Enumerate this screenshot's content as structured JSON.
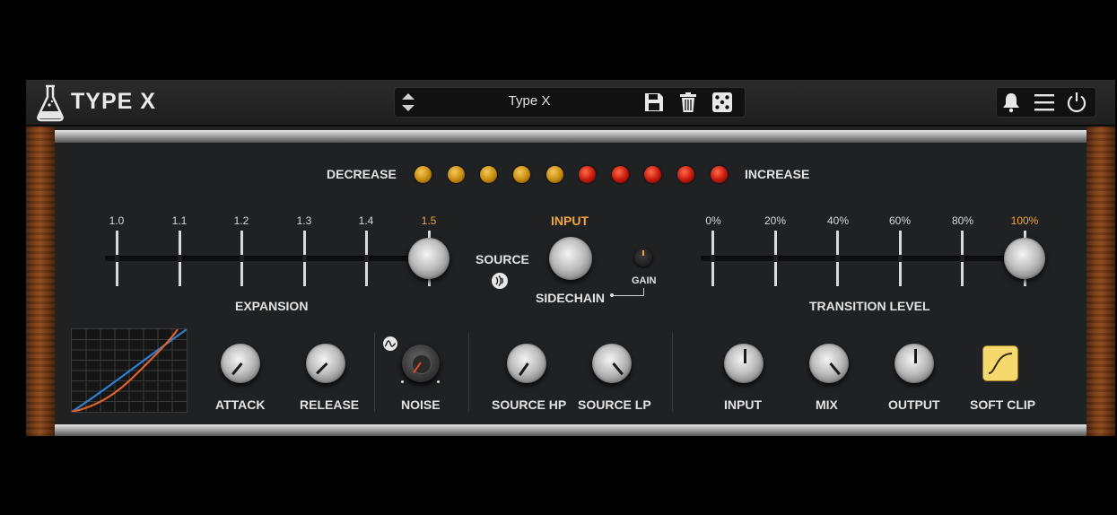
{
  "header": {
    "title": "TYPE X",
    "preset_name": "Type X",
    "icons": [
      "flask-icon",
      "preset-arrows-icon",
      "save-icon",
      "trash-icon",
      "dice-icon",
      "bell-icon",
      "menu-icon",
      "power-icon"
    ]
  },
  "meter": {
    "decrease_label": "DECREASE",
    "increase_label": "INCREASE",
    "leds": [
      "amber",
      "amber",
      "amber",
      "amber",
      "amber",
      "red",
      "red",
      "red",
      "red",
      "red"
    ]
  },
  "expansion": {
    "label": "EXPANSION",
    "ticks": [
      "1.0",
      "1.1",
      "1.2",
      "1.3",
      "1.4",
      "1.5"
    ],
    "selected_index": 5
  },
  "center": {
    "input_label": "INPUT",
    "source_label": "SOURCE",
    "sidechain_label": "SIDECHAIN",
    "gain_label": "GAIN"
  },
  "transition": {
    "label": "TRANSITION LEVEL",
    "ticks": [
      "0%",
      "20%",
      "40%",
      "60%",
      "80%",
      "100%"
    ],
    "selected_index": 5
  },
  "knobs": {
    "attack": "ATTACK",
    "release": "RELEASE",
    "noise": "NOISE",
    "source_hp": "SOURCE HP",
    "source_lp": "SOURCE LP",
    "input": "INPUT",
    "mix": "MIX",
    "output": "OUTPUT",
    "soft_clip": "SOFT CLIP"
  },
  "colors": {
    "accent_orange": "#f1a43c",
    "led_amber": "#d49a15",
    "led_red": "#c4170c",
    "soft_clip_on": "#f5d96e",
    "curve_blue": "#2f7fd0",
    "curve_orange": "#e0622a"
  }
}
